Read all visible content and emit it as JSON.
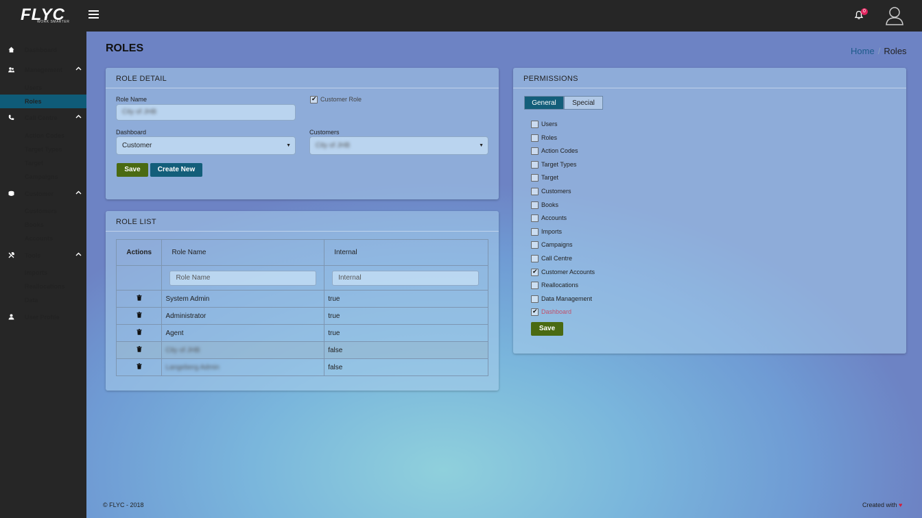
{
  "brand": {
    "logo_text": "FLYC",
    "tagline": "WORK SMARTER"
  },
  "topbar": {
    "notification_count": "0"
  },
  "sidebar": {
    "groups": [
      {
        "label": "Dashboard",
        "icon": "home-icon"
      },
      {
        "label": "Management",
        "icon": "users-icon",
        "items": [
          "Users",
          "Roles"
        ]
      },
      {
        "label": "Call Centre",
        "icon": "phone-icon",
        "items": [
          "Action Codes",
          "Target Types",
          "Target",
          "Campaigns"
        ]
      },
      {
        "label": "Customer",
        "icon": "coins-icon",
        "items": [
          "Customers",
          "Books",
          "Accounts"
        ]
      },
      {
        "label": "Tools",
        "icon": "tools-icon",
        "items": [
          "Imports",
          "Reallocations",
          "Data"
        ]
      },
      {
        "label": "User Profile",
        "icon": "user-icon"
      }
    ],
    "active_item": "Roles"
  },
  "page": {
    "title": "ROLES"
  },
  "breadcrumb": {
    "home": "Home",
    "separator": "/",
    "current": "Roles"
  },
  "role_detail": {
    "header": "ROLE DETAIL",
    "role_name_label": "Role Name",
    "role_name_value": "City of JHB",
    "customer_role_label": "Customer Role",
    "customer_role_checked": true,
    "dashboard_label": "Dashboard",
    "dashboard_value": "Customer",
    "customers_label": "Customers",
    "customers_value": "City of JHB",
    "save_label": "Save",
    "create_new_label": "Create New"
  },
  "role_list": {
    "header": "ROLE LIST",
    "columns": [
      "Actions",
      "Role Name",
      "Internal"
    ],
    "filter_placeholders": {
      "role_name": "Role Name",
      "internal": "Internal"
    },
    "rows": [
      {
        "name": "System Admin",
        "internal": "true"
      },
      {
        "name": "Administrator",
        "internal": "true"
      },
      {
        "name": "Agent",
        "internal": "true"
      },
      {
        "name": "City of JHB",
        "internal": "false"
      },
      {
        "name": "Langeberg Admin",
        "internal": "false"
      }
    ]
  },
  "permissions": {
    "header": "PERMISSIONS",
    "tabs": [
      "General",
      "Special"
    ],
    "active_tab": "General",
    "items": [
      {
        "label": "Users",
        "checked": false
      },
      {
        "label": "Roles",
        "checked": false
      },
      {
        "label": "Action Codes",
        "checked": false
      },
      {
        "label": "Target Types",
        "checked": false
      },
      {
        "label": "Target",
        "checked": false
      },
      {
        "label": "Customers",
        "checked": false
      },
      {
        "label": "Books",
        "checked": false
      },
      {
        "label": "Accounts",
        "checked": false
      },
      {
        "label": "Imports",
        "checked": false
      },
      {
        "label": "Campaigns",
        "checked": false
      },
      {
        "label": "Call Centre",
        "checked": false
      },
      {
        "label": "Customer Accounts",
        "checked": true
      },
      {
        "label": "Reallocations",
        "checked": false
      },
      {
        "label": "Data Management",
        "checked": false
      },
      {
        "label": "Dashboard",
        "checked": true
      }
    ],
    "save_label": "Save"
  },
  "footer": {
    "copyright": "© FLYC - 2018",
    "created_with": "Created with"
  },
  "colors": {
    "sidebar_bg": "#262626",
    "active_nav": "#0f5b78",
    "btn_green": "#4a6a12",
    "btn_blue": "#135e7a",
    "badge": "#e0245e"
  }
}
